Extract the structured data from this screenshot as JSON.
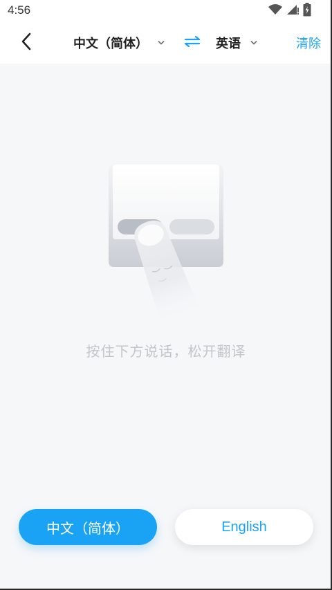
{
  "status_bar": {
    "time": "4:56",
    "icons": [
      "wifi-icon",
      "signal-icon",
      "battery-icon"
    ]
  },
  "header": {
    "source_language": "中文（简体）",
    "target_language": "英语",
    "clear_label": "清除",
    "icons": [
      "back-arrow-icon",
      "chevron-down-icon",
      "swap-icon"
    ]
  },
  "main": {
    "hint": "按住下方说话，松开翻译"
  },
  "bottom": {
    "source_button_label": "中文（简体）",
    "target_button_label": "English"
  },
  "colors": {
    "accent": "#1aa3f5",
    "background": "#f6f7f9",
    "hint_text": "#c3c5c8"
  }
}
